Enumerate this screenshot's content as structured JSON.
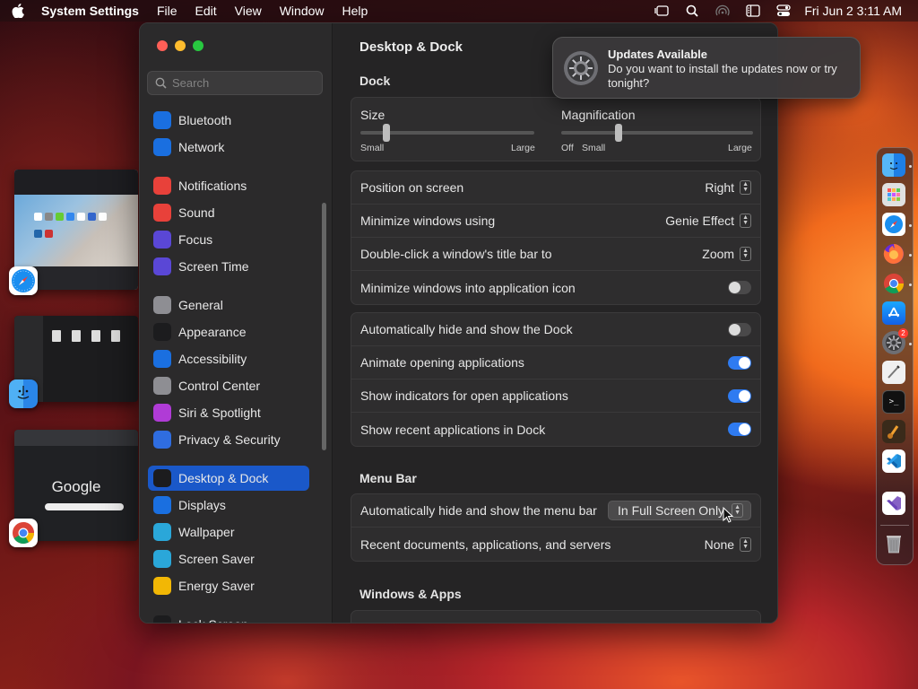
{
  "menubar": {
    "app_name": "System Settings",
    "menus": [
      "File",
      "Edit",
      "View",
      "Window",
      "Help"
    ],
    "clock": "Fri Jun 2  3:11 AM"
  },
  "window": {
    "title": "Desktop & Dock",
    "search_placeholder": "Search",
    "sidebar": [
      {
        "label": "Bluetooth",
        "icon": "bluetooth-icon",
        "color": "#1a6fe0"
      },
      {
        "label": "Network",
        "icon": "globe-icon",
        "color": "#1a6fe0"
      },
      {
        "label": "Notifications",
        "icon": "bell-icon",
        "color": "#e8413a"
      },
      {
        "label": "Sound",
        "icon": "speaker-icon",
        "color": "#e8413a"
      },
      {
        "label": "Focus",
        "icon": "moon-icon",
        "color": "#5a47d6"
      },
      {
        "label": "Screen Time",
        "icon": "hourglass-icon",
        "color": "#5a47d6"
      },
      {
        "label": "General",
        "icon": "gear-icon",
        "color": "#8e8e93"
      },
      {
        "label": "Appearance",
        "icon": "appearance-icon",
        "color": "#1c1c1e"
      },
      {
        "label": "Accessibility",
        "icon": "accessibility-icon",
        "color": "#1a6fe0"
      },
      {
        "label": "Control Center",
        "icon": "control-center-icon",
        "color": "#8e8e93"
      },
      {
        "label": "Siri & Spotlight",
        "icon": "siri-icon",
        "color": "#b03bd6"
      },
      {
        "label": "Privacy & Security",
        "icon": "hand-icon",
        "color": "#2f6de0"
      },
      {
        "label": "Desktop & Dock",
        "icon": "dock-icon",
        "color": "#1c1c1e",
        "selected": true
      },
      {
        "label": "Displays",
        "icon": "sun-icon",
        "color": "#1a6fe0"
      },
      {
        "label": "Wallpaper",
        "icon": "flower-icon",
        "color": "#2aa7d9"
      },
      {
        "label": "Screen Saver",
        "icon": "screen-saver-icon",
        "color": "#2aa7d9"
      },
      {
        "label": "Energy Saver",
        "icon": "bulb-icon",
        "color": "#f2b705"
      },
      {
        "label": "Lock Screen",
        "icon": "lock-icon",
        "color": "#1c1c1e"
      }
    ],
    "dock_section": {
      "header": "Dock",
      "size": {
        "label": "Size",
        "min_label": "Small",
        "max_label": "Large",
        "value": 0.15
      },
      "magnification": {
        "label": "Magnification",
        "off_label": "Off",
        "min_label": "Small",
        "max_label": "Large",
        "value": 0.3
      },
      "position": {
        "label": "Position on screen",
        "value": "Right"
      },
      "minimize": {
        "label": "Minimize windows using",
        "value": "Genie Effect"
      },
      "double_click": {
        "label": "Double-click a window's title bar to",
        "value": "Zoom"
      },
      "minimize_into_icon": {
        "label": "Minimize windows into application icon",
        "on": false
      },
      "auto_hide": {
        "label": "Automatically hide and show the Dock",
        "on": false
      },
      "animate": {
        "label": "Animate opening applications",
        "on": true
      },
      "indicators": {
        "label": "Show indicators for open applications",
        "on": true
      },
      "recent_apps": {
        "label": "Show recent applications in Dock",
        "on": true
      }
    },
    "menubar_section": {
      "header": "Menu Bar",
      "auto_hide_menubar": {
        "label": "Automatically hide and show the menu bar",
        "value": "In Full Screen Only"
      },
      "recent_docs": {
        "label": "Recent documents, applications, and servers",
        "value": "None"
      }
    },
    "windows_section": {
      "header": "Windows & Apps"
    }
  },
  "notification": {
    "title": "Updates Available",
    "body": "Do you want to install the updates now or try tonight?"
  },
  "stage_thumbs": {
    "google_label": "Google"
  },
  "dock_apps": [
    "finder-icon",
    "launchpad-icon",
    "safari-icon",
    "firefox-icon",
    "chrome-icon",
    "app-store-icon",
    "system-settings-icon",
    "script-editor-icon",
    "terminal-icon",
    "instruments-icon",
    "vscode-icon",
    "visual-studio-icon",
    "trash-icon"
  ],
  "dock_badge": "2"
}
